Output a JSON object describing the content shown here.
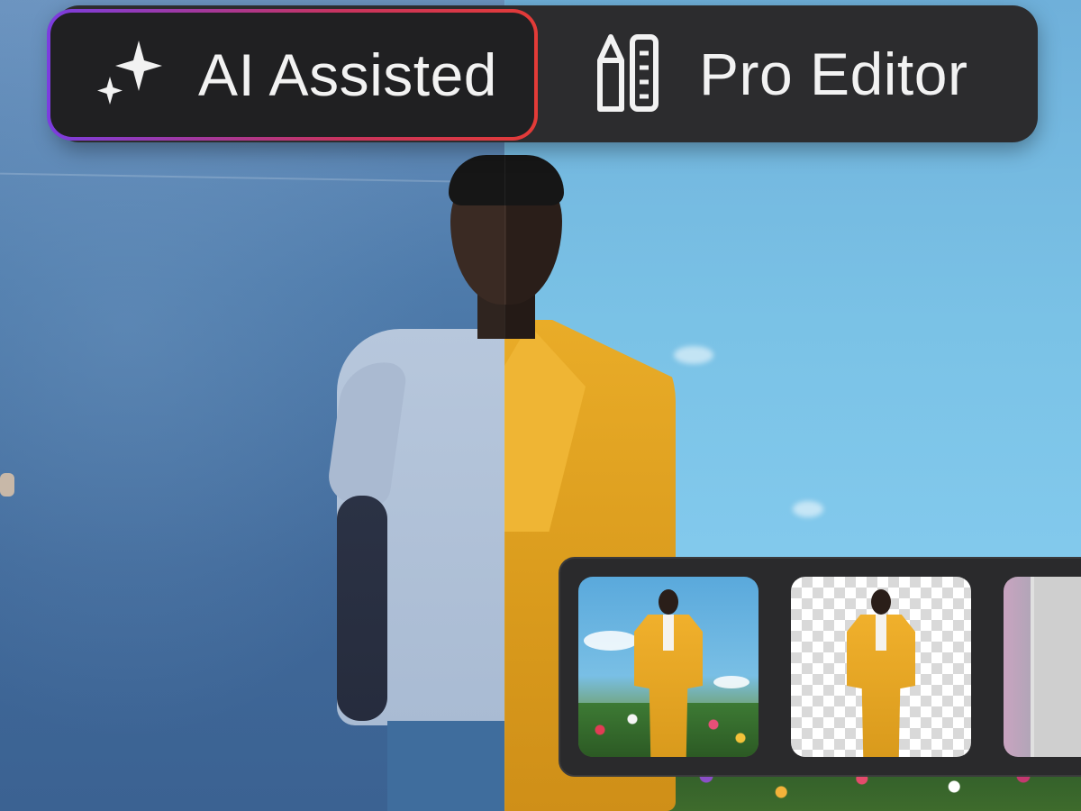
{
  "mode_toggle": {
    "ai": {
      "label": "AI Assisted",
      "icon": "sparkles-icon",
      "selected": true
    },
    "pro": {
      "label": "Pro Editor",
      "icon": "pencil-ruler-icon",
      "selected": false
    }
  },
  "colors": {
    "toggle_bg": "#2c2c2e",
    "selected_border_start": "#7b3de0",
    "selected_border_end": "#e33b37",
    "suit": "#e9ac28"
  },
  "thumbnails": [
    {
      "name": "flower-field-thumbnail"
    },
    {
      "name": "transparent-background-thumbnail"
    },
    {
      "name": "concrete-scene-thumbnail"
    }
  ]
}
